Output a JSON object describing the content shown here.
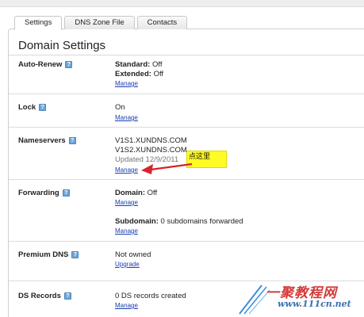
{
  "tabs": [
    {
      "label": "Settings",
      "active": true
    },
    {
      "label": "DNS Zone File",
      "active": false
    },
    {
      "label": "Contacts",
      "active": false
    }
  ],
  "section_title": "Domain Settings",
  "rows": {
    "auto_renew": {
      "label": "Auto-Renew",
      "standard_key": "Standard:",
      "standard_val": " Off",
      "extended_key": "Extended:",
      "extended_val": " Off",
      "link": "Manage"
    },
    "lock": {
      "label": "Lock",
      "value": "On",
      "link": "Manage"
    },
    "nameservers": {
      "label": "Nameservers",
      "ns1": "V1S1.XUNDNS.COM",
      "ns2": "V1S2.XUNDNS.COM",
      "updated": "Updated 12/9/2011",
      "link": "Manage"
    },
    "forwarding": {
      "label": "Forwarding",
      "domain_key": "Domain:",
      "domain_val": " Off",
      "link1": "Manage",
      "subdomain_key": "Subdomain:",
      "subdomain_val": " 0 subdomains forwarded",
      "link2": "Manage"
    },
    "premium_dns": {
      "label": "Premium DNS",
      "value": "Not owned",
      "link": "Upgrade"
    },
    "ds_records": {
      "label": "DS Records",
      "value": "0 DS records created",
      "link": "Manage"
    }
  },
  "help_icon_glyph": "?",
  "callout_text": "点这里",
  "watermark": {
    "cn": "一聚教程网",
    "url": "www.111cn.net"
  },
  "colors": {
    "link": "#1a3fb0",
    "callout": "#fffb24",
    "arrow": "#d9232a",
    "help_icon": "#6ea6d8"
  }
}
